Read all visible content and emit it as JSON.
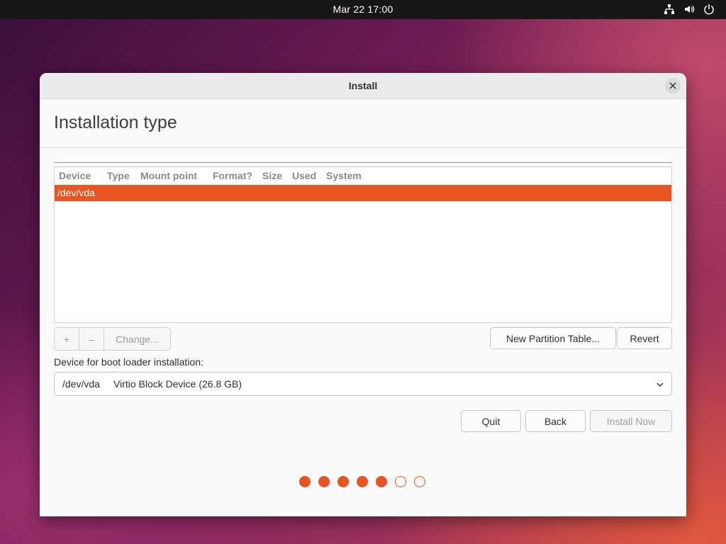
{
  "topbar": {
    "clock": "Mar 22  17:00",
    "icons": [
      "network-icon",
      "volume-icon",
      "power-icon"
    ]
  },
  "window": {
    "title": "Install",
    "heading": "Installation type",
    "table": {
      "columns": [
        "Device",
        "Type",
        "Mount point",
        "Format?",
        "Size",
        "Used",
        "System"
      ],
      "rows": [
        {
          "device": "/dev/vda",
          "selected": true
        }
      ]
    },
    "partition_buttons": {
      "add": "+",
      "remove": "–",
      "change": "Change..."
    },
    "new_partition_table": "New Partition Table...",
    "revert": "Revert",
    "boot_loader_label": "Device for boot loader installation:",
    "boot_loader_select": {
      "device": "/dev/vda",
      "description": "Virtio Block Device (26.8 GB)"
    },
    "buttons": {
      "quit": "Quit",
      "back": "Back",
      "install_now": "Install Now"
    },
    "progress": {
      "completed_steps": 5,
      "total_steps": 7
    }
  },
  "colors": {
    "accent": "#e95420",
    "topbar": "#171717"
  }
}
